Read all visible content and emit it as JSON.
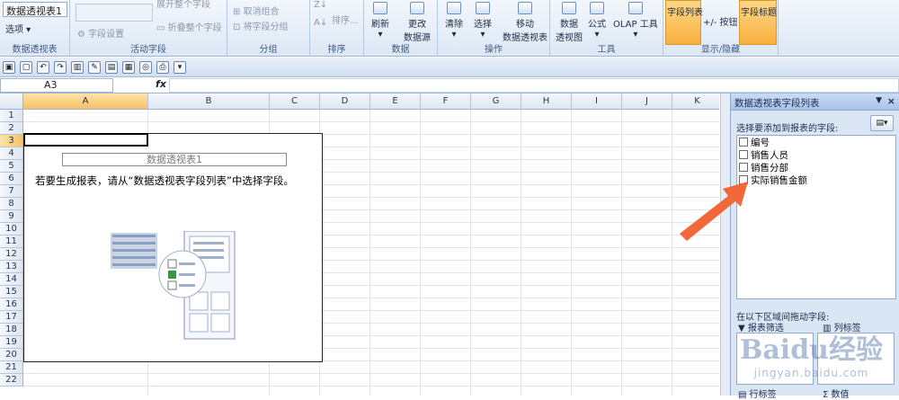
{
  "ribbon": {
    "pivot_name": "数据透视表1",
    "options_label": "选项",
    "group_pivot": "数据透视表",
    "field_settings": "字段设置",
    "expand_field": "展开整个字段",
    "collapse_field": "折叠整个字段",
    "group_active": "活动字段",
    "ungroup": "取消组合",
    "group_field": "将字段分组",
    "group_group": "分组",
    "sort": "排序...",
    "group_sort": "排序",
    "refresh": "刷新",
    "change_source": "更改\n数据源",
    "group_data": "数据",
    "clear": "清除",
    "select": "选择",
    "move_pivot": "移动\n数据透视表",
    "group_actions": "操作",
    "pivot_chart": "数据\n透视图",
    "formulas": "公式",
    "olap_tools": "OLAP 工具",
    "group_tools": "工具",
    "field_list_btn": "字段列表",
    "plus_minus_btn": "+/- 按钮",
    "field_headers_btn": "字段标题",
    "group_show": "显示/隐藏"
  },
  "formula_bar": {
    "name_box": "A3",
    "fx": "fx",
    "formula": ""
  },
  "grid": {
    "columns": [
      "A",
      "B",
      "C",
      "D",
      "E",
      "F",
      "G",
      "H",
      "I",
      "J",
      "K"
    ],
    "rows": [
      "1",
      "2",
      "3",
      "4",
      "5",
      "6",
      "7",
      "8",
      "9",
      "10",
      "11",
      "12",
      "13",
      "14",
      "15",
      "16",
      "17",
      "18",
      "19",
      "20",
      "21",
      "22"
    ],
    "active_cell": "A3"
  },
  "pivot": {
    "title": "数据透视表1",
    "message": "若要生成报表，请从“数据透视表字段列表”中选择字段。"
  },
  "panel": {
    "title": "数据透视表字段列表",
    "choose_label": "选择要添加到报表的字段:",
    "fields": [
      "编号",
      "销售人员",
      "销售分部",
      "实际销售金额"
    ],
    "drag_label": "在以下区域间拖动字段:",
    "report_filter": "报表筛选",
    "column_labels": "列标签",
    "row_labels": "行标签",
    "values": "数值"
  },
  "watermark": {
    "brand": "Baidu经验",
    "url": "jingyan.baidu.com"
  },
  "colors": {
    "accent": "#f9b040",
    "arrow": "#f2683a",
    "panel_bg": "#dae6f4"
  }
}
